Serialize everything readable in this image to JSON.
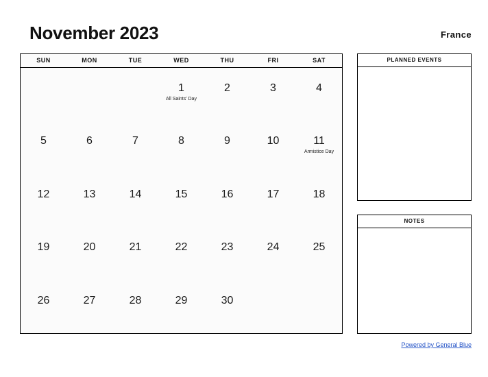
{
  "header": {
    "title": "November 2023",
    "region": "France"
  },
  "calendar": {
    "day_headers": [
      "SUN",
      "MON",
      "TUE",
      "WED",
      "THU",
      "FRI",
      "SAT"
    ],
    "weeks": [
      [
        {
          "day": "",
          "holiday": ""
        },
        {
          "day": "",
          "holiday": ""
        },
        {
          "day": "",
          "holiday": ""
        },
        {
          "day": "1",
          "holiday": "All Saints' Day"
        },
        {
          "day": "2",
          "holiday": ""
        },
        {
          "day": "3",
          "holiday": ""
        },
        {
          "day": "4",
          "holiday": ""
        }
      ],
      [
        {
          "day": "5",
          "holiday": ""
        },
        {
          "day": "6",
          "holiday": ""
        },
        {
          "day": "7",
          "holiday": ""
        },
        {
          "day": "8",
          "holiday": ""
        },
        {
          "day": "9",
          "holiday": ""
        },
        {
          "day": "10",
          "holiday": ""
        },
        {
          "day": "11",
          "holiday": "Armistice Day"
        }
      ],
      [
        {
          "day": "12",
          "holiday": ""
        },
        {
          "day": "13",
          "holiday": ""
        },
        {
          "day": "14",
          "holiday": ""
        },
        {
          "day": "15",
          "holiday": ""
        },
        {
          "day": "16",
          "holiday": ""
        },
        {
          "day": "17",
          "holiday": ""
        },
        {
          "day": "18",
          "holiday": ""
        }
      ],
      [
        {
          "day": "19",
          "holiday": ""
        },
        {
          "day": "20",
          "holiday": ""
        },
        {
          "day": "21",
          "holiday": ""
        },
        {
          "day": "22",
          "holiday": ""
        },
        {
          "day": "23",
          "holiday": ""
        },
        {
          "day": "24",
          "holiday": ""
        },
        {
          "day": "25",
          "holiday": ""
        }
      ],
      [
        {
          "day": "26",
          "holiday": ""
        },
        {
          "day": "27",
          "holiday": ""
        },
        {
          "day": "28",
          "holiday": ""
        },
        {
          "day": "29",
          "holiday": ""
        },
        {
          "day": "30",
          "holiday": ""
        },
        {
          "day": "",
          "holiday": ""
        },
        {
          "day": "",
          "holiday": ""
        }
      ]
    ]
  },
  "panels": {
    "planned_events": {
      "title": "PLANNED EVENTS",
      "content": ""
    },
    "notes": {
      "title": "NOTES",
      "content": ""
    }
  },
  "footer": {
    "link_label": "Powered by General Blue"
  },
  "colors": {
    "link": "#2554c7",
    "border": "#000000",
    "cell_background": "#fbfbfb",
    "text": "#111111"
  }
}
